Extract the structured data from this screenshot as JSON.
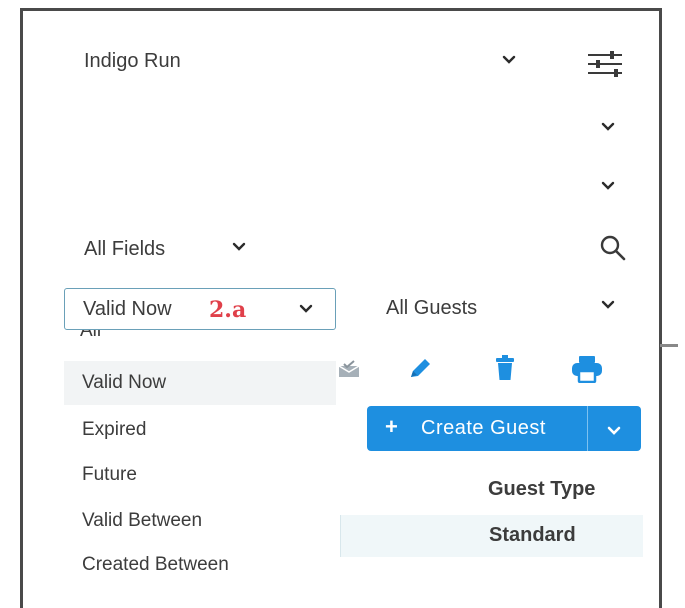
{
  "header": {
    "title": "Indigo Run"
  },
  "search": {
    "field_select": "All Fields"
  },
  "filter": {
    "validity_value": "Valid Now",
    "annotation": "2.a"
  },
  "guests_select": {
    "value": "All Guests"
  },
  "validity_dropdown": {
    "clipped_top_item": "All",
    "items": [
      {
        "label": "Valid Now",
        "selected": true
      },
      {
        "label": "Expired",
        "selected": false
      },
      {
        "label": "Future",
        "selected": false
      },
      {
        "label": "Valid Between",
        "selected": false
      },
      {
        "label": "Created Between",
        "selected": false
      }
    ]
  },
  "toolbar": {
    "icons": [
      "check-mail-icon",
      "pencil-icon",
      "trash-icon",
      "printer-icon"
    ],
    "create_label": "Create Guest",
    "create_plus": "+"
  },
  "table": {
    "column_header": "Guest Type",
    "rows": [
      "Standard"
    ]
  },
  "colors": {
    "primary": "#1e8fe0",
    "icon_blue": "#1e8fe0",
    "badge_red": "#e0404a"
  }
}
